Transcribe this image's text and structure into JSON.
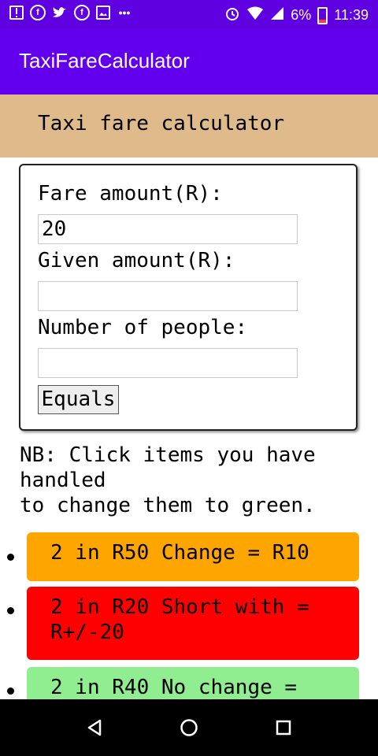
{
  "status_bar": {
    "left_icons": [
      "alert-icon",
      "facebook-icon",
      "twitter-icon",
      "facebook-icon",
      "image-icon",
      "more-dots-icon"
    ],
    "battery": "6%",
    "time": "11:39"
  },
  "app_bar": {
    "title": "TaxiFareCalculator"
  },
  "header": {
    "title": "Taxi fare calculator"
  },
  "form": {
    "fare_label": "Fare amount(R):",
    "fare_value": "20",
    "given_label": "Given amount(R):",
    "given_value": "",
    "people_label": "Number of people:",
    "people_value": "",
    "button_label": "Equals"
  },
  "note": "NB: Click items you have handled\nto change them to green.",
  "items": [
    {
      "text": "2 in R50 Change = R10",
      "color": "#ffa500"
    },
    {
      "text": "2 in R20 Short with = R+/-20",
      "color": "#ff0000"
    },
    {
      "text": "2 in R40 No change =",
      "color": "#90ee90"
    }
  ],
  "nav": {
    "back": "back-icon",
    "home": "home-icon",
    "recents": "recents-icon"
  }
}
